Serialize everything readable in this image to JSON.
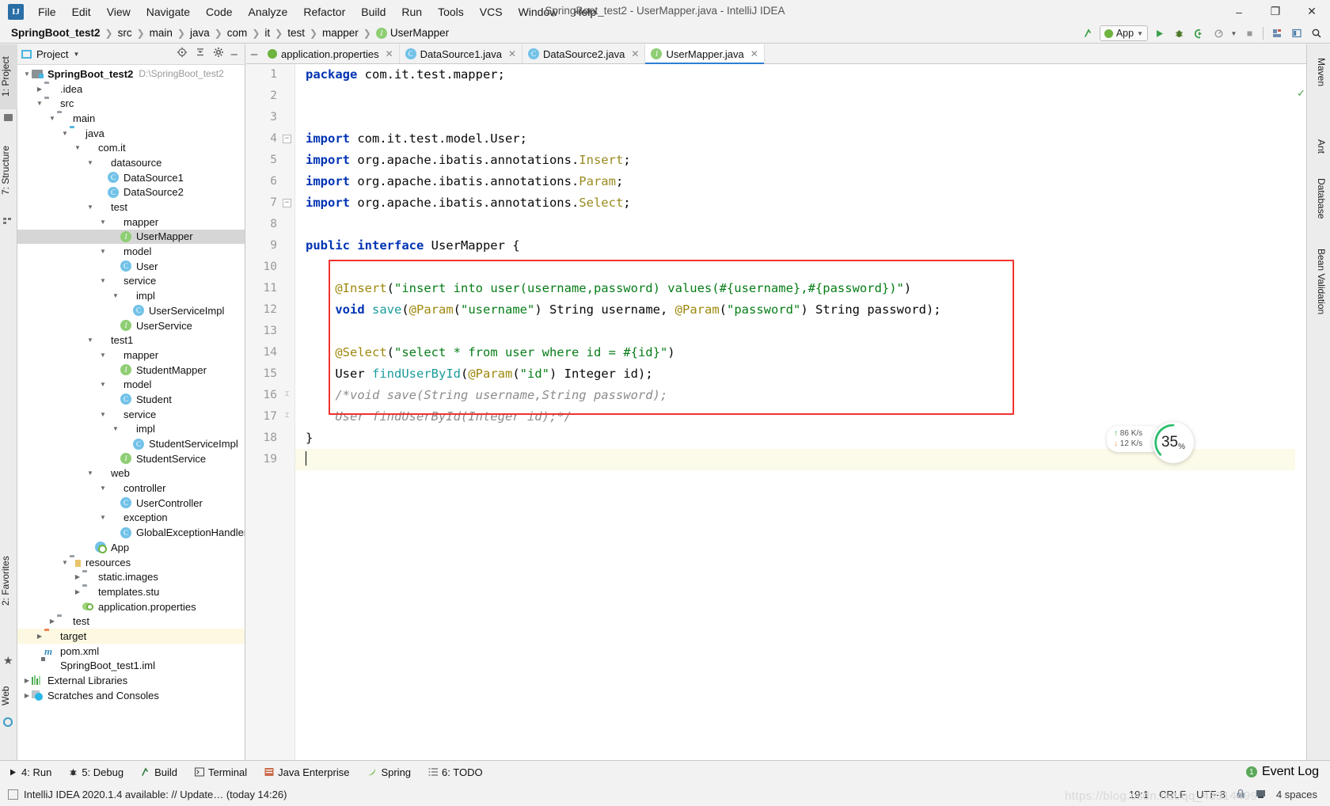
{
  "window": {
    "title": "SpringBoot_test2 - UserMapper.java - IntelliJ IDEA",
    "logo_text": "IJ",
    "minimize": "–",
    "maximize": "❐",
    "close": "✕"
  },
  "menu": [
    {
      "label": "File"
    },
    {
      "label": "Edit"
    },
    {
      "label": "View"
    },
    {
      "label": "Navigate"
    },
    {
      "label": "Code"
    },
    {
      "label": "Analyze"
    },
    {
      "label": "Refactor"
    },
    {
      "label": "Build"
    },
    {
      "label": "Run"
    },
    {
      "label": "Tools"
    },
    {
      "label": "VCS"
    },
    {
      "label": "Window"
    },
    {
      "label": "Help"
    }
  ],
  "breadcrumbs": [
    {
      "label": "SpringBoot_test2",
      "bold": true
    },
    {
      "label": "src"
    },
    {
      "label": "main"
    },
    {
      "label": "java"
    },
    {
      "label": "com"
    },
    {
      "label": "it"
    },
    {
      "label": "test"
    },
    {
      "label": "mapper"
    },
    {
      "label": "UserMapper",
      "icon": "interface-icon"
    }
  ],
  "toolbar": {
    "run_config": "App",
    "run_label": "Run",
    "debug_label": "Debug",
    "coverage_label": "Run with Coverage",
    "profile_label": "Profile",
    "stop_label": "Stop",
    "search_label": "Search Everywhere",
    "updates_label": "Update Project"
  },
  "left_tool_strip": [
    {
      "label": "1: Project",
      "selected": true
    },
    {
      "label": "7: Structure",
      "selected": false
    },
    {
      "label": "2: Favorites",
      "selected": false
    },
    {
      "label": "Web",
      "selected": false
    }
  ],
  "right_tool_strip": [
    {
      "label": "Maven"
    },
    {
      "label": "Ant"
    },
    {
      "label": "Database"
    },
    {
      "label": "Bean Validation"
    }
  ],
  "project_panel": {
    "title": "Project",
    "icons": [
      "locate-icon",
      "collapse-all-icon",
      "gear-icon",
      "hide-icon"
    ],
    "tree": [
      {
        "depth": 0,
        "arrow": "down",
        "icon": "module-icon",
        "label": "SpringBoot_test2",
        "bold": true,
        "path": "D:\\SpringBoot_test2"
      },
      {
        "depth": 1,
        "arrow": "right",
        "icon": "folder-icon",
        "label": ".idea"
      },
      {
        "depth": 1,
        "arrow": "down",
        "icon": "folder-icon",
        "label": "src"
      },
      {
        "depth": 2,
        "arrow": "down",
        "icon": "folder-icon",
        "label": "main"
      },
      {
        "depth": 3,
        "arrow": "down",
        "icon": "source-folder-icon",
        "label": "java"
      },
      {
        "depth": 4,
        "arrow": "down",
        "icon": "package-icon",
        "label": "com.it"
      },
      {
        "depth": 5,
        "arrow": "down",
        "icon": "package-icon",
        "label": "datasource"
      },
      {
        "depth": 6,
        "arrow": "none",
        "icon": "class-icon",
        "label": "DataSource1"
      },
      {
        "depth": 6,
        "arrow": "none",
        "icon": "class-icon",
        "label": "DataSource2"
      },
      {
        "depth": 5,
        "arrow": "down",
        "icon": "package-icon",
        "label": "test"
      },
      {
        "depth": 6,
        "arrow": "down",
        "icon": "package-icon",
        "label": "mapper"
      },
      {
        "depth": 7,
        "arrow": "none",
        "icon": "interface-icon",
        "label": "UserMapper",
        "selected": true
      },
      {
        "depth": 6,
        "arrow": "down",
        "icon": "package-icon",
        "label": "model"
      },
      {
        "depth": 7,
        "arrow": "none",
        "icon": "class-icon",
        "label": "User"
      },
      {
        "depth": 6,
        "arrow": "down",
        "icon": "package-icon",
        "label": "service"
      },
      {
        "depth": 7,
        "arrow": "down",
        "icon": "package-icon",
        "label": "impl"
      },
      {
        "depth": 8,
        "arrow": "none",
        "icon": "class-icon",
        "label": "UserServiceImpl"
      },
      {
        "depth": 7,
        "arrow": "none",
        "icon": "interface-icon",
        "label": "UserService"
      },
      {
        "depth": 5,
        "arrow": "down",
        "icon": "package-icon",
        "label": "test1"
      },
      {
        "depth": 6,
        "arrow": "down",
        "icon": "package-icon",
        "label": "mapper"
      },
      {
        "depth": 7,
        "arrow": "none",
        "icon": "interface-icon",
        "label": "StudentMapper"
      },
      {
        "depth": 6,
        "arrow": "down",
        "icon": "package-icon",
        "label": "model"
      },
      {
        "depth": 7,
        "arrow": "none",
        "icon": "class-icon",
        "label": "Student"
      },
      {
        "depth": 6,
        "arrow": "down",
        "icon": "package-icon",
        "label": "service"
      },
      {
        "depth": 7,
        "arrow": "down",
        "icon": "package-icon",
        "label": "impl"
      },
      {
        "depth": 8,
        "arrow": "none",
        "icon": "class-icon",
        "label": "StudentServiceImpl"
      },
      {
        "depth": 7,
        "arrow": "none",
        "icon": "interface-icon",
        "label": "StudentService"
      },
      {
        "depth": 5,
        "arrow": "down",
        "icon": "package-icon",
        "label": "web"
      },
      {
        "depth": 6,
        "arrow": "down",
        "icon": "package-icon",
        "label": "controller"
      },
      {
        "depth": 7,
        "arrow": "none",
        "icon": "class-icon",
        "label": "UserController"
      },
      {
        "depth": 6,
        "arrow": "down",
        "icon": "package-icon",
        "label": "exception"
      },
      {
        "depth": 7,
        "arrow": "none",
        "icon": "class-icon",
        "label": "GlobalExceptionHandler"
      },
      {
        "depth": 5,
        "arrow": "none",
        "icon": "spring-app-icon",
        "label": "App"
      },
      {
        "depth": 3,
        "arrow": "down",
        "icon": "resources-folder-icon",
        "label": "resources"
      },
      {
        "depth": 4,
        "arrow": "right",
        "icon": "folder-icon",
        "label": "static.images"
      },
      {
        "depth": 4,
        "arrow": "right",
        "icon": "folder-icon",
        "label": "templates.stu"
      },
      {
        "depth": 4,
        "arrow": "none",
        "icon": "spring-config-icon",
        "label": "application.properties"
      },
      {
        "depth": 2,
        "arrow": "right",
        "icon": "folder-icon",
        "label": "test"
      },
      {
        "depth": 1,
        "arrow": "right",
        "icon": "target-folder-icon",
        "label": "target",
        "highlight": true
      },
      {
        "depth": 1,
        "arrow": "none",
        "icon": "maven-icon",
        "label": "pom.xml"
      },
      {
        "depth": 1,
        "arrow": "none",
        "icon": "iml-icon",
        "label": "SpringBoot_test1.iml"
      },
      {
        "depth": 0,
        "arrow": "right",
        "icon": "libraries-icon",
        "label": "External Libraries"
      },
      {
        "depth": 0,
        "arrow": "right",
        "icon": "scratches-icon",
        "label": "Scratches and Consoles"
      }
    ]
  },
  "editor_tabs": [
    {
      "label": "application.properties",
      "icon": "spring-config-icon",
      "active": false
    },
    {
      "label": "DataSource1.java",
      "icon": "class-icon",
      "active": false
    },
    {
      "label": "DataSource2.java",
      "icon": "class-icon",
      "active": false
    },
    {
      "label": "UserMapper.java",
      "icon": "interface-icon",
      "active": true
    }
  ],
  "code": {
    "line_numbers": [
      "1",
      "2",
      "3",
      "4",
      "5",
      "6",
      "7",
      "8",
      "9",
      "10",
      "11",
      "12",
      "13",
      "14",
      "15",
      "16",
      "17",
      "18",
      "19"
    ],
    "lines": [
      [
        {
          "t": "package ",
          "c": "kw"
        },
        {
          "t": "com.it.test.mapper;",
          "c": "plain"
        }
      ],
      [],
      [],
      [
        {
          "t": "import ",
          "c": "kw"
        },
        {
          "t": "com.it.test.model.User;",
          "c": "plain"
        }
      ],
      [
        {
          "t": "import ",
          "c": "kw"
        },
        {
          "t": "org.apache.ibatis.annotations.",
          "c": "plain"
        },
        {
          "t": "Insert",
          "c": "cls"
        },
        {
          "t": ";",
          "c": "plain"
        }
      ],
      [
        {
          "t": "import ",
          "c": "kw"
        },
        {
          "t": "org.apache.ibatis.annotations.",
          "c": "plain"
        },
        {
          "t": "Param",
          "c": "cls"
        },
        {
          "t": ";",
          "c": "plain"
        }
      ],
      [
        {
          "t": "import ",
          "c": "kw"
        },
        {
          "t": "org.apache.ibatis.annotations.",
          "c": "plain"
        },
        {
          "t": "Select",
          "c": "cls"
        },
        {
          "t": ";",
          "c": "plain"
        }
      ],
      [],
      [
        {
          "t": "public interface ",
          "c": "kw"
        },
        {
          "t": "UserMapper {",
          "c": "plain"
        }
      ],
      [],
      [
        {
          "t": "    ",
          "c": "plain"
        },
        {
          "t": "@Insert",
          "c": "ann"
        },
        {
          "t": "(",
          "c": "plain"
        },
        {
          "t": "\"insert into user(username,password) values(#{username},#{password})\"",
          "c": "str"
        },
        {
          "t": ")",
          "c": "plain"
        }
      ],
      [
        {
          "t": "    ",
          "c": "plain"
        },
        {
          "t": "void ",
          "c": "kw"
        },
        {
          "t": "save",
          "c": "mth"
        },
        {
          "t": "(",
          "c": "plain"
        },
        {
          "t": "@Param",
          "c": "ann"
        },
        {
          "t": "(",
          "c": "plain"
        },
        {
          "t": "\"username\"",
          "c": "str"
        },
        {
          "t": ") String username, ",
          "c": "plain"
        },
        {
          "t": "@Param",
          "c": "ann"
        },
        {
          "t": "(",
          "c": "plain"
        },
        {
          "t": "\"password\"",
          "c": "str"
        },
        {
          "t": ") String password);",
          "c": "plain"
        }
      ],
      [],
      [
        {
          "t": "    ",
          "c": "plain"
        },
        {
          "t": "@Select",
          "c": "ann"
        },
        {
          "t": "(",
          "c": "plain"
        },
        {
          "t": "\"select * from user where id = #{id}\"",
          "c": "str"
        },
        {
          "t": ")",
          "c": "plain"
        }
      ],
      [
        {
          "t": "    User ",
          "c": "plain"
        },
        {
          "t": "findUserById",
          "c": "mth"
        },
        {
          "t": "(",
          "c": "plain"
        },
        {
          "t": "@Param",
          "c": "ann"
        },
        {
          "t": "(",
          "c": "plain"
        },
        {
          "t": "\"id\"",
          "c": "str"
        },
        {
          "t": ") Integer id);",
          "c": "plain"
        }
      ],
      [
        {
          "t": "    /*void save(String username,String password);",
          "c": "cmt"
        }
      ],
      [
        {
          "t": "    User findUserById(Integer id);*/",
          "c": "cmt"
        }
      ],
      [
        {
          "t": "}",
          "c": "plain"
        }
      ],
      []
    ]
  },
  "net_widget": {
    "upload": "86",
    "upload_unit": "K/s",
    "download": "12",
    "download_unit": "K/s",
    "percent": "35",
    "percent_sign": "%",
    "up_arrow": "↑",
    "down_arrow": "↓"
  },
  "bottom_bar": {
    "items": [
      {
        "label": "4: Run",
        "icon": "run-icon"
      },
      {
        "label": "5: Debug",
        "icon": "debug-icon"
      },
      {
        "label": "Build",
        "icon": "build-icon"
      },
      {
        "label": "Terminal",
        "icon": "terminal-icon"
      },
      {
        "label": "Java Enterprise",
        "icon": "java-ee-icon"
      },
      {
        "label": "Spring",
        "icon": "spring-icon"
      },
      {
        "label": "6: TODO",
        "icon": "todo-icon"
      }
    ],
    "event_log": "Event Log",
    "event_count": "1"
  },
  "status_bar": {
    "message": "IntelliJ IDEA 2020.1.4 available: // Update… (today 14:26)",
    "caret_position": "19:1",
    "line_separator": "CRLF",
    "encoding": "UTF-8",
    "indent": "4 spaces",
    "watermark": "https://blog.csdn.net/qq_43314499"
  }
}
